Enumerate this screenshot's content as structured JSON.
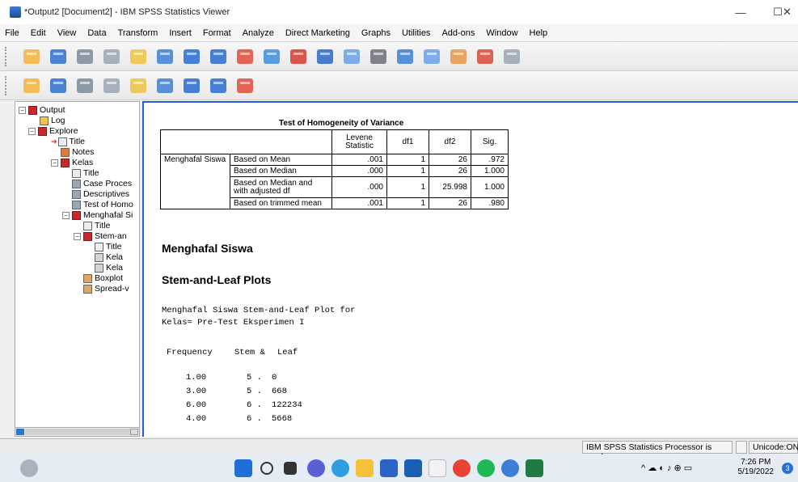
{
  "window": {
    "title": "*Output2 [Document2] - IBM SPSS Statistics Viewer",
    "minimize": "—",
    "maximize": "☐",
    "close": "✕"
  },
  "menu": [
    "File",
    "Edit",
    "View",
    "Data",
    "Transform",
    "Insert",
    "Format",
    "Analyze",
    "Direct Marketing",
    "Graphs",
    "Utilities",
    "Add-ons",
    "Window",
    "Help"
  ],
  "toolbar1_icons": [
    "open-icon",
    "save-icon",
    "print-icon",
    "print-preview-icon",
    "export-icon",
    "recall-dialog-icon",
    "undo-icon",
    "redo-icon",
    "goto-data-icon",
    "goto-case-icon",
    "variables-icon",
    "output-icon",
    "select-last-output-icon",
    "designate-window-icon",
    "scripting-icon",
    "custom-dialog-icon",
    "chart-builder-icon",
    "pivot-table-icon",
    "disabled-icon"
  ],
  "toolbar2_icons": [
    "promote-icon",
    "demote-icon",
    "expand-icon",
    "collapse-icon",
    "show-icon",
    "hide-icon",
    "insert-heading-icon",
    "insert-title-icon",
    "insert-text-icon"
  ],
  "outline": {
    "output": "Output",
    "log": "Log",
    "explore": "Explore",
    "title": "Title",
    "notes": "Notes",
    "kelas": "Kelas",
    "kelas_title": "Title",
    "case_processing": "Case Proces",
    "descriptives": "Descriptives",
    "test_homo": "Test of Homo",
    "menghafal": "Menghafal Si",
    "menghafal_title": "Title",
    "stem": "Stem-an",
    "stem_title": "Title",
    "kelas_a": "Kela",
    "kelas_b": "Kela",
    "boxplot": "Boxplot",
    "spread": "Spread-v"
  },
  "homogeneity": {
    "title": "Test of Homogeneity of Variance",
    "headers": [
      "Levene Statistic",
      "df1",
      "df2",
      "Sig."
    ],
    "variable": "Menghafal Siswa",
    "rows": [
      {
        "label": "Based on Mean",
        "levene": ".001",
        "df1": "1",
        "df2": "26",
        "sig": ".972"
      },
      {
        "label": "Based on Median",
        "levene": ".000",
        "df1": "1",
        "df2": "26",
        "sig": "1.000"
      },
      {
        "label": "Based on Median and with adjusted df",
        "levene": ".000",
        "df1": "1",
        "df2": "25.998",
        "sig": "1.000"
      },
      {
        "label": "Based on trimmed mean",
        "levene": ".001",
        "df1": "1",
        "df2": "26",
        "sig": ".980"
      }
    ]
  },
  "section_title": "Menghafal Siswa",
  "stemleaf_heading": "Stem-and-Leaf Plots",
  "plot_caption_1": "Menghafal Siswa Stem-and-Leaf Plot for",
  "plot_caption_2": "Kelas= Pre-Test Eksperimen I",
  "plot_header": {
    "frequency": "Frequency",
    "stem": "Stem &",
    "leaf": "Leaf"
  },
  "plot_rows": [
    {
      "freq": "1.00",
      "stem": "5 .",
      "leaf": "0"
    },
    {
      "freq": "3.00",
      "stem": "5 .",
      "leaf": "668"
    },
    {
      "freq": "6.00",
      "stem": "6 .",
      "leaf": "122234"
    },
    {
      "freq": "4.00",
      "stem": "6 .",
      "leaf": "5668"
    }
  ],
  "status": {
    "processor": "IBM SPSS Statistics Processor is ready",
    "encoding": "Unicode:ON"
  },
  "taskbar": {
    "time": "7:26 PM",
    "date": "5/19/2022",
    "notifications": "3"
  }
}
